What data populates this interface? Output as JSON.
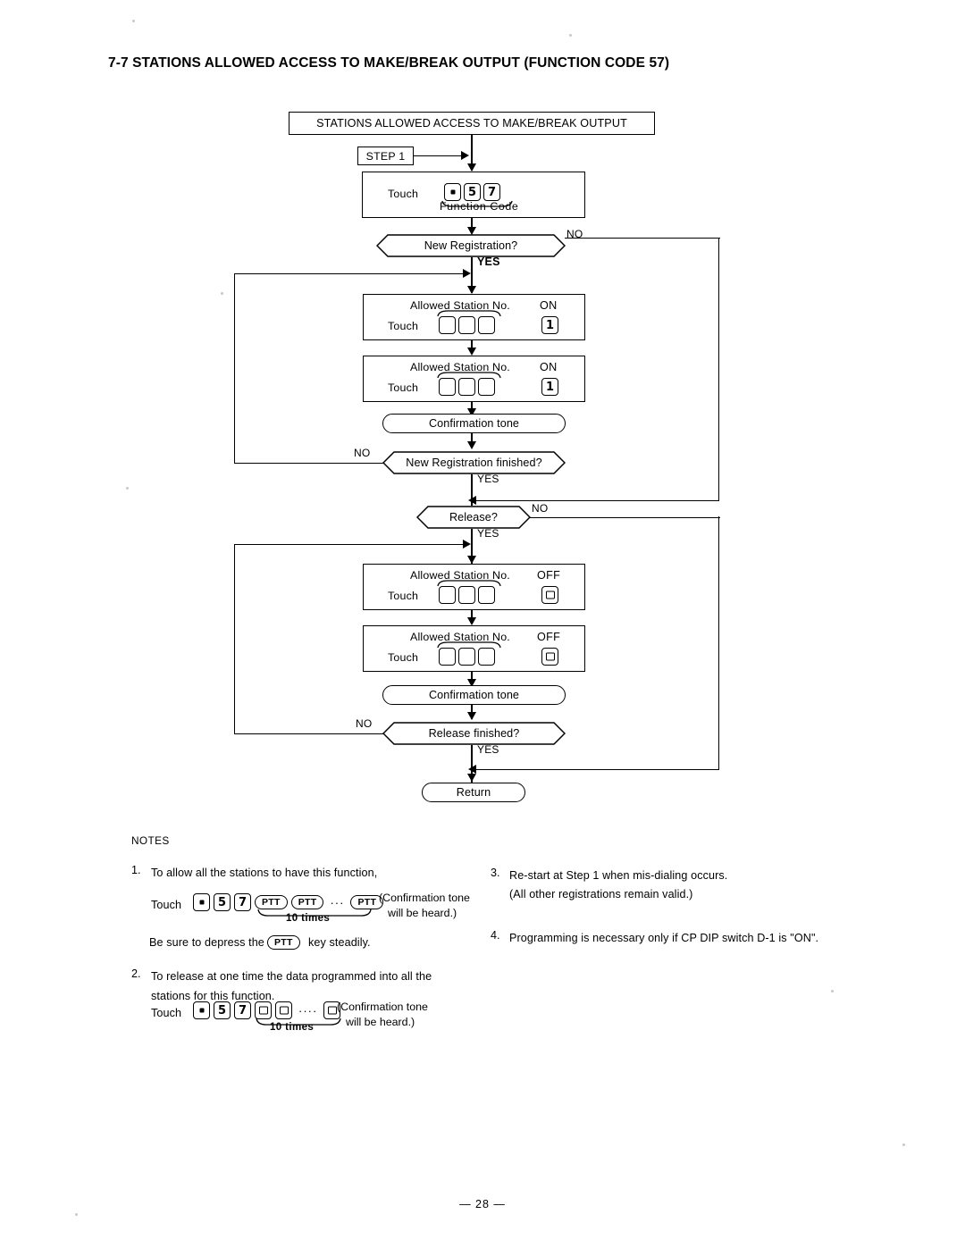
{
  "document": {
    "section_number": "7-7",
    "title": "7-7 STATIONS ALLOWED ACCESS TO MAKE/BREAK OUTPUT (FUNCTION CODE 57)",
    "page_number": "— 28 —"
  },
  "flowchart": {
    "header_box": "STATIONS ALLOWED ACCESS TO MAKE/BREAK OUTPUT",
    "step_label": "STEP 1",
    "touch_label": "Touch",
    "function_code_label": "Function  Code",
    "function_code_keys": [
      "•",
      "5",
      "7"
    ],
    "nodes": {
      "new_registration": "New Registration?",
      "new_registration_finished": "New Registration finished?",
      "release": "Release?",
      "release_finished": "Release finished?",
      "confirmation_tone_1": "Confirmation tone",
      "confirmation_tone_2": "Confirmation tone",
      "return": "Return"
    },
    "station_boxes": [
      {
        "heading": "Allowed Station No.",
        "touch": "Touch",
        "state": "ON",
        "state_key": "1",
        "digits": 3
      },
      {
        "heading": "Allowed Station No.",
        "touch": "Touch",
        "state": "ON",
        "state_key": "1",
        "digits": 3
      },
      {
        "heading": "Allowed Station No.",
        "touch": "Touch",
        "state": "OFF",
        "state_key": "0",
        "digits": 3
      },
      {
        "heading": "Allowed Station No.",
        "touch": "Touch",
        "state": "OFF",
        "state_key": "0",
        "digits": 3
      }
    ],
    "branch_labels": {
      "yes": "YES",
      "no": "NO"
    }
  },
  "notes": {
    "heading": "NOTES",
    "items": [
      {
        "number": "1.",
        "text": "To allow all the stations to have this function,",
        "touch_label": "Touch",
        "keys": [
          "•",
          "5",
          "7"
        ],
        "repeat_keys": [
          "PTT",
          "PTT",
          "PTT"
        ],
        "ellipsis": "···",
        "repeat_caption": "10 times",
        "paren_line1": "(Confirmation tone",
        "paren_line2": "will be heard.)",
        "footer_before": "Be sure to depress the",
        "footer_key": "PTT",
        "footer_after": "key steadily."
      },
      {
        "number": "2.",
        "text_line1": "To release at one time the data programmed into all the",
        "text_line2": "stations for this function.",
        "touch_label": "Touch",
        "keys": [
          "•",
          "5",
          "7"
        ],
        "repeat_keys": [
          "0",
          "0",
          "0"
        ],
        "ellipsis": "····",
        "repeat_caption": "10 times",
        "paren_line1": "(Confirmation tone",
        "paren_line2": "will be heard.)"
      },
      {
        "number": "3.",
        "text_line1": "Re-start at Step 1 when mis-dialing occurs.",
        "text_line2": "(All other registrations remain valid.)"
      },
      {
        "number": "4.",
        "text_line1": "Programming is necessary only if CP DIP switch D-1 is \"ON\"."
      }
    ]
  },
  "colors": {
    "ink": "#000000",
    "paper": "#ffffff"
  }
}
